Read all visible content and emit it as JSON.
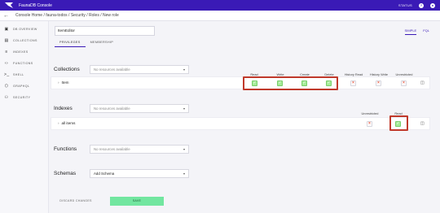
{
  "app": {
    "brand": "FaunaDB Console",
    "status": "STATUS",
    "help_label": "?",
    "account_label": "●"
  },
  "breadcrumb": {
    "back_icon": "arrow-left-icon",
    "text": "Console Home / fauna-todos / Security / Roles / New role"
  },
  "sidebar": {
    "items": [
      {
        "label": "DB OVERVIEW",
        "icon": "▣"
      },
      {
        "label": "COLLECTIONS",
        "icon": "▤"
      },
      {
        "label": "INDEXES",
        "icon": "≡"
      },
      {
        "label": "FUNCTIONS",
        "icon": "‹›"
      },
      {
        "label": "SHELL",
        "icon": ">_"
      },
      {
        "label": "GRAPHQL",
        "icon": "⬡"
      },
      {
        "label": "SECURITY",
        "icon": "⚇"
      }
    ]
  },
  "role_form": {
    "name_value": "ItemEditor",
    "mode_tabs": [
      "SIMPLE",
      "FQL"
    ],
    "tabs": [
      "PRIVILEGES",
      "MEMBERSHIP"
    ]
  },
  "collections": {
    "title": "Collections",
    "select_placeholder": "No resources available",
    "columns": [
      "Read",
      "Write",
      "Create",
      "Delete",
      "History Read",
      "History Write",
      "Unrestricted"
    ],
    "rows": [
      {
        "name": "Item",
        "values": [
          true,
          true,
          true,
          true,
          false,
          false,
          false
        ]
      }
    ]
  },
  "indexes": {
    "title": "Indexes",
    "select_placeholder": "No resources available",
    "columns": [
      "Unrestricted",
      "Read"
    ],
    "rows": [
      {
        "name": "all items",
        "values": [
          false,
          true
        ]
      }
    ]
  },
  "functions": {
    "title": "Functions",
    "select_placeholder": "No resources available"
  },
  "schemas": {
    "title": "Schemas",
    "select_value": "Add Schema"
  },
  "actions": {
    "discard_label": "DISCARD CHANGES",
    "save_label": "SAVE"
  },
  "colors": {
    "topbar": "#3a1ab6",
    "checked": "#a5eb98",
    "unchecked_x": "#e8563e",
    "highlight": "#c0392b",
    "save": "#72e6a0"
  },
  "glyphs": {
    "caret": "▾",
    "row_arrow": "›",
    "check": "✓",
    "cross": "×",
    "trash": "🗑"
  }
}
